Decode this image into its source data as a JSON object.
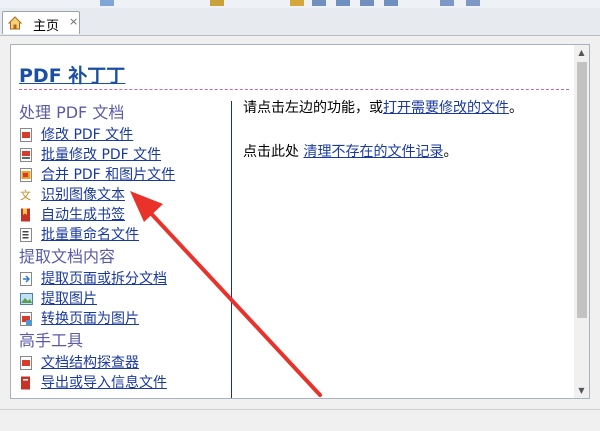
{
  "tab": {
    "label": "主页",
    "close": "×"
  },
  "page": {
    "title": "PDF 补丁丁"
  },
  "left": {
    "sections": [
      {
        "title": "处理 PDF 文档",
        "items": [
          "修改 PDF 文件",
          "批量修改 PDF 文件",
          "合并 PDF 和图片文件",
          "识别图像文本",
          "自动生成书签",
          "批量重命名文件"
        ]
      },
      {
        "title": "提取文档内容",
        "items": [
          "提取页面或拆分文档",
          "提取图片",
          "转换页面为图片"
        ]
      },
      {
        "title": "高手工具",
        "items": [
          "文档结构探查器",
          "导出或导入信息文件"
        ]
      }
    ]
  },
  "right": {
    "line1_prefix": "请点击左边的功能，或",
    "line1_link": "打开需要修改的文件",
    "line1_suffix": "。",
    "line2_prefix": "点击此处 ",
    "line2_link": "清理不存在的文件记录",
    "line2_suffix": "。"
  },
  "icons": {
    "tab": "home-icon",
    "items": [
      "pdf-edit-icon",
      "pdf-batch-icon",
      "pdf-merge-icon",
      "ocr-icon",
      "bookmark-icon",
      "rename-icon",
      "extract-pages-icon",
      "extract-image-icon",
      "page-to-image-icon",
      "structure-icon",
      "info-file-icon"
    ]
  },
  "colors": {
    "link": "#1a3aa0",
    "section": "#5a5aa8",
    "title": "#1b4fa3",
    "arrow": "#e8322a"
  }
}
